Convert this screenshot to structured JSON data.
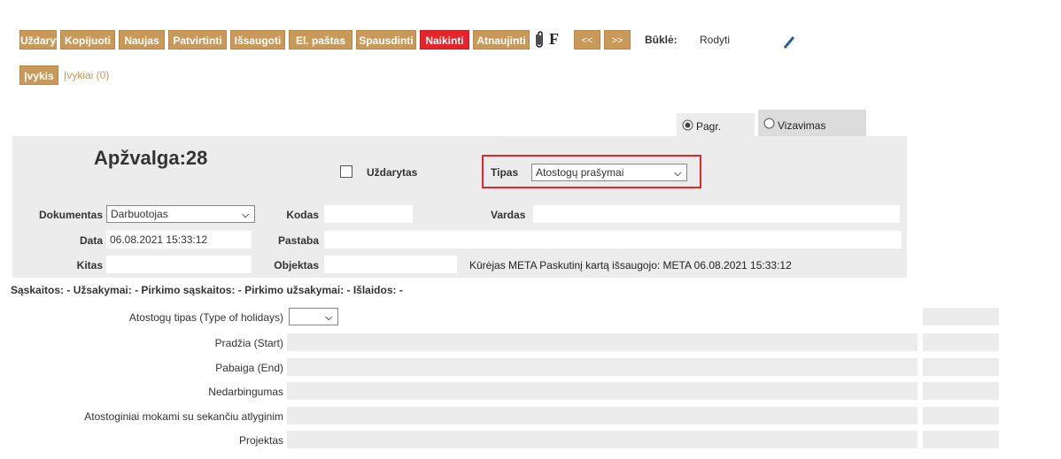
{
  "toolbar": {
    "buttons": [
      "Uždaryti",
      "Kopijuoti",
      "Naujas",
      "Patvirtinti",
      "Išsaugoti",
      "El. paštas",
      "Spausdinti",
      "Naikinti",
      "Atnaujinti"
    ],
    "f_label": "F",
    "prev": "<<",
    "next": ">>",
    "state_label": "Būklė:",
    "state_value": "Rodyti",
    "event_button": "Įvykis",
    "events_link": "Įvykiai (0)"
  },
  "tabs": {
    "main": "Pagr.",
    "approval": "Vizavimas"
  },
  "header": {
    "title": "Apžvalga:28",
    "closed_label": "Uždarytas",
    "type_label": "Tipas",
    "type_value": "Atostogų prašymai"
  },
  "form": {
    "document_label": "Dokumentas",
    "document_value": "Darbuotojas",
    "code_label": "Kodas",
    "name_label": "Vardas",
    "date_label": "Data",
    "date_value": "06.08.2021 15:33:12",
    "note_label": "Pastaba",
    "other_label": "Kitas",
    "object_label": "Objektas",
    "creator_info": "Kūrėjas META  Paskutinį kartą išsaugojo: META 06.08.2021 15:33:12"
  },
  "summary": "Sąskaitos: - Užsakymai: - Pirkimo sąskaitos: - Pirkimo užsakymai: - Išlaidos: -",
  "fields": {
    "holiday_type": "Atostogų tipas (Type of holidays)",
    "start": "Pradžia (Start)",
    "end": "Pabaiga (End)",
    "disability": "Nedarbingumas",
    "pay": "Atostoginiai mokami su sekančiu atlyginim",
    "projects": "Projektas"
  },
  "colors": {
    "button": "#c9995a",
    "delete": "#e8242b",
    "highlight": "#e8242b",
    "panel": "#ececec"
  }
}
